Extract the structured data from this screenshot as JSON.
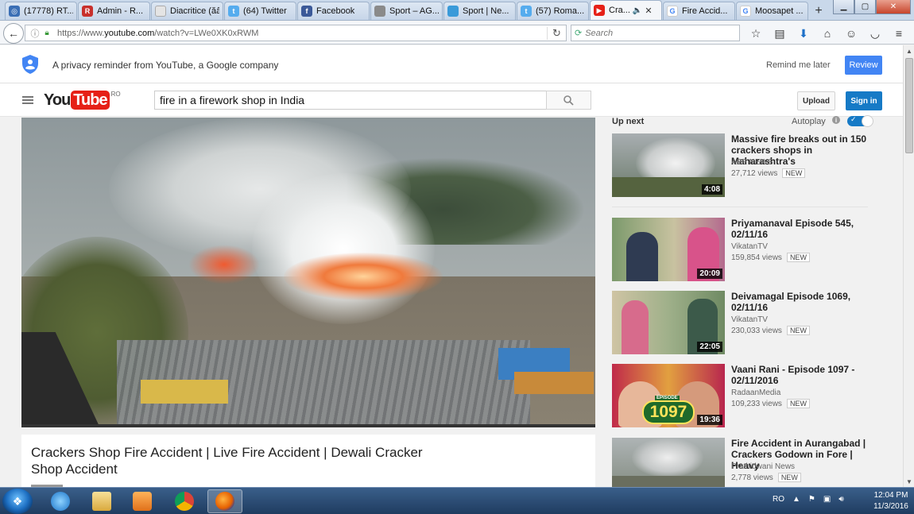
{
  "browser": {
    "tabs": [
      {
        "label": "(17778) RT...",
        "icon": "globe-icon",
        "color": "#3b6fb5"
      },
      {
        "label": "Admin - R...",
        "icon": "r-icon",
        "color": "#c8302c"
      },
      {
        "label": "Diacritice (ăâîș...",
        "icon": "page-icon",
        "color": "#cccccc"
      },
      {
        "label": "(64) Twitter",
        "icon": "twitter-icon",
        "color": "#55acee"
      },
      {
        "label": "Facebook",
        "icon": "facebook-icon",
        "color": "#3b5998"
      },
      {
        "label": "Sport – AG...",
        "icon": "page-icon",
        "color": "#8a8a8a"
      },
      {
        "label": "Sport | Ne...",
        "icon": "page-icon",
        "color": "#3a9ad9"
      },
      {
        "label": "(57) Roma...",
        "icon": "twitter-icon",
        "color": "#55acee"
      },
      {
        "label": "Cra...",
        "icon": "youtube-icon",
        "color": "#e62117",
        "active": true,
        "audio": true
      },
      {
        "label": "Fire Accid...",
        "icon": "google-icon",
        "color": "#4285f4"
      },
      {
        "label": "Moosapet ...",
        "icon": "google-icon",
        "color": "#4285f4"
      }
    ],
    "new_tab": "+",
    "url_prefix": "https://www.",
    "url_domain": "youtube.com",
    "url_path": "/watch?v=LWe0XK0xRWM",
    "search_placeholder": "Search"
  },
  "privacy": {
    "message": "A privacy reminder from YouTube, a Google company",
    "remind_label": "Remind me later",
    "review_label": "Review"
  },
  "header": {
    "logo_you": "You",
    "logo_tube": "Tube",
    "country": "RO",
    "search_value": "fire in a firework shop in India",
    "upload_label": "Upload",
    "signin_label": "Sign in"
  },
  "video": {
    "title": "Crackers Shop Fire Accident | Live Fire Accident | Dewali Cracker Shop Accident"
  },
  "sidebar": {
    "up_next": "Up next",
    "autoplay": "Autoplay",
    "items": [
      {
        "title": "Massive fire breaks out in 150 crackers shops in Maharashtra's",
        "channel": "ABP NEWS",
        "views": "27,712 views",
        "badge": "NEW",
        "duration": "4:08"
      },
      {
        "title": "Priyamanaval Episode 545, 02/11/16",
        "channel": "VikatanTV",
        "views": "159,854 views",
        "badge": "NEW",
        "duration": "20:09"
      },
      {
        "title": "Deivamagal Episode 1069, 02/11/16",
        "channel": "VikatanTV",
        "views": "230,033 views",
        "badge": "NEW",
        "duration": "22:05"
      },
      {
        "title": "Vaani Rani - Episode 1097 - 02/11/2016",
        "channel": "RadaanMedia",
        "views": "109,233 views",
        "badge": "NEW",
        "duration": "19:36",
        "thumb_text": "1097",
        "thumb_label": "EPISODE"
      },
      {
        "title": "Fire Accident in Aurangabad | Crackers Godown in Fore | Heavy",
        "channel": "Prathidwani News",
        "views": "2,778 views",
        "badge": "NEW",
        "duration": ""
      }
    ]
  },
  "taskbar": {
    "language": "RO",
    "time": "12:04 PM",
    "date": "11/3/2016"
  }
}
